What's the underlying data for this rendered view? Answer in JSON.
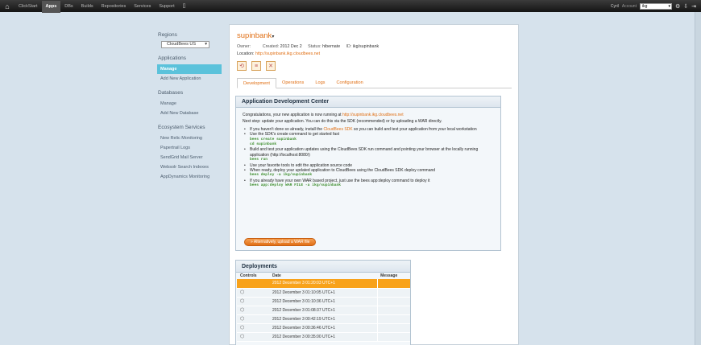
{
  "topnav": {
    "items": [
      "ClickStart",
      "Apps",
      "DBs",
      "Builds",
      "Repositories",
      "Services",
      "Support"
    ],
    "active": "Apps",
    "user": "Cyril",
    "account_label": "Account",
    "account_value": "ikg"
  },
  "sidebar": {
    "regions_heading": "Regions",
    "region_value": "CloudBees US",
    "applications_heading": "Applications",
    "applications_items": [
      "Manage",
      "Add New Application"
    ],
    "databases_heading": "Databases",
    "databases_items": [
      "Manage",
      "Add New Database"
    ],
    "ecosystem_heading": "Ecosystem Services",
    "ecosystem_items": [
      "New Relic Monitoring",
      "Papertrail Logs",
      "SendGrid Mail Server",
      "Websolr Search Indexes",
      "AppDynamics Monitoring"
    ]
  },
  "app": {
    "title": "supinbank",
    "owner_label": "Owner:",
    "owner_value": "",
    "created_label": "Created:",
    "created_value": "2012 Dec 2",
    "status_label": "Status:",
    "status_value": "hibernate",
    "id_label": "ID:",
    "id_value": "ikg/supinbank",
    "location_label": "Location:",
    "location_value": "http://supinbank.ikg.cloudbees.net"
  },
  "tabs": [
    "Development",
    "Operations",
    "Logs",
    "Configuration"
  ],
  "adc": {
    "title": "Application Development Center",
    "congrats": "Congratulations, your new application is now running at",
    "congrats_link": "http://supinbank.ikg.cloudbees.net",
    "next_step": "Next step: update your application. You can do this via the SDK (recommended) or by uploading a WAR directly.",
    "b1_pre": "If you haven't done so already, install the",
    "b1_link": "CloudBees SDK",
    "b1_post": "so you can build and test your application from your local workstation",
    "b2": "Use the SDK's create command to get started fast",
    "b2_code1": "bees create supinbank",
    "b2_code2": "cd supinbank",
    "b3": "Build and test your application updates using the CloudBees SDK run command and pointing your browser at the locally running application (http://localhost:8080/)",
    "b3_code": "bees run",
    "b4": "Use your favorite tools to edit the application source code",
    "b5": "When ready, deploy your updated application to CloudBees using the CloudBees SDK deploy command",
    "b5_code": "bees deploy -a ikg/supinbank",
    "b6": "If you already have your own WAR based project, just use the bees app:deploy command to deploy it",
    "b6_code": "bees app:deploy WAR FILE -a ikg/supinbank",
    "upload_button": "» Alternatively, upload a WAR file"
  },
  "deployments": {
    "title": "Deployments",
    "headers": [
      "Controls",
      "Date",
      "Message"
    ],
    "rows": [
      {
        "date": "2012 December 3 01:20:03 UTC+1",
        "message": ""
      },
      {
        "date": "2012 December 3 01:10:05 UTC+1",
        "message": ""
      },
      {
        "date": "2012 December 3 01:10:36 UTC+1",
        "message": ""
      },
      {
        "date": "2012 December 3 01:08:37 UTC+1",
        "message": ""
      },
      {
        "date": "2012 December 3 00:42:19 UTC+1",
        "message": ""
      },
      {
        "date": "2012 December 3 00:36:46 UTC+1",
        "message": ""
      },
      {
        "date": "2012 December 3 00:35:00 UTC+1",
        "message": ""
      }
    ]
  },
  "icons": {
    "home": "home-icon",
    "gear": "gear-icon",
    "download": "download-icon",
    "logout": "logout-icon"
  }
}
